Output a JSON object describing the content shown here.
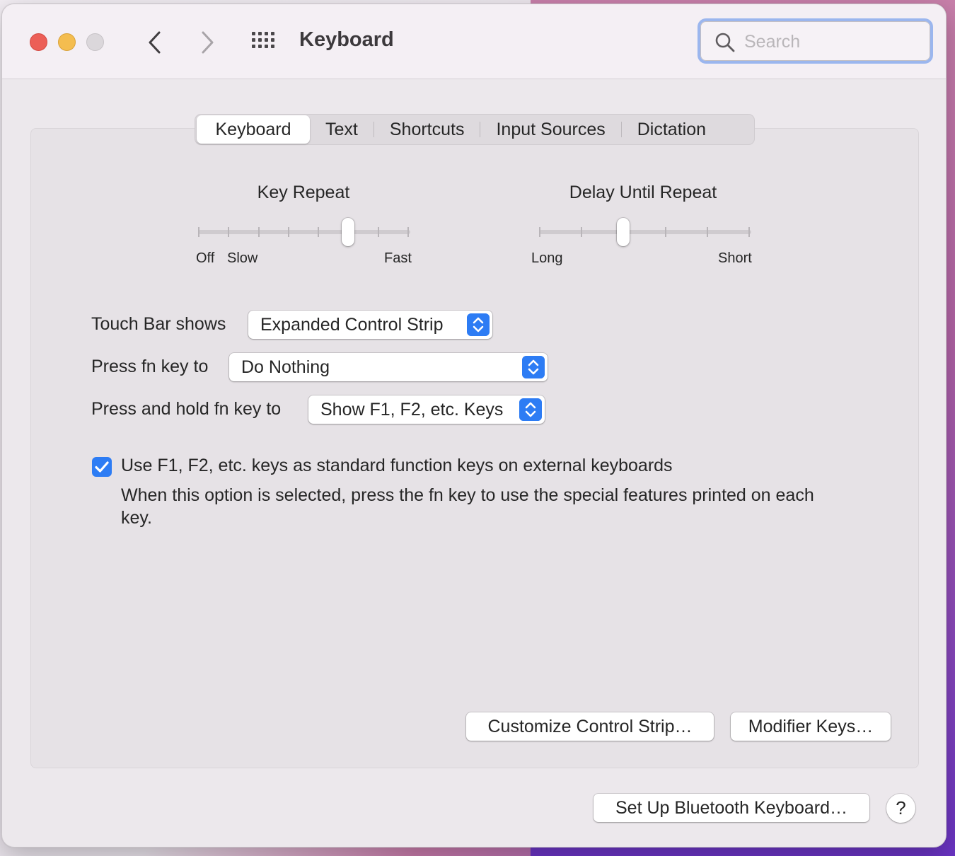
{
  "window": {
    "title": "Keyboard"
  },
  "search": {
    "placeholder": "Search"
  },
  "tabs": [
    {
      "label": "Keyboard",
      "active": true
    },
    {
      "label": "Text"
    },
    {
      "label": "Shortcuts"
    },
    {
      "label": "Input Sources"
    },
    {
      "label": "Dictation"
    }
  ],
  "key_repeat": {
    "title": "Key Repeat",
    "labels": {
      "off": "Off",
      "slow": "Slow",
      "fast": "Fast"
    },
    "ticks": 8,
    "selected_index": 5
  },
  "delay_until_repeat": {
    "title": "Delay Until Repeat",
    "labels": {
      "long": "Long",
      "short": "Short"
    },
    "ticks": 6,
    "selected_index": 2
  },
  "settings": {
    "touch_bar": {
      "label": "Touch Bar shows",
      "value": "Expanded Control Strip"
    },
    "fn_key": {
      "label": "Press fn key to",
      "value": "Do Nothing"
    },
    "hold_fn": {
      "label": "Press and hold fn key to",
      "value": "Show F1, F2, etc. Keys"
    }
  },
  "function_keys": {
    "checked": true,
    "label": "Use F1, F2, etc. keys as standard function keys on external keyboards",
    "description": "When this option is selected, press the fn key to use the special features printed on each key."
  },
  "buttons": {
    "customize": "Customize Control Strip…",
    "modifier": "Modifier Keys…",
    "bluetooth": "Set Up Bluetooth Keyboard…",
    "help": "?"
  },
  "colors": {
    "accent": "#2d7cf4",
    "close": "#ec5f57",
    "minimize": "#f4bd4f"
  }
}
